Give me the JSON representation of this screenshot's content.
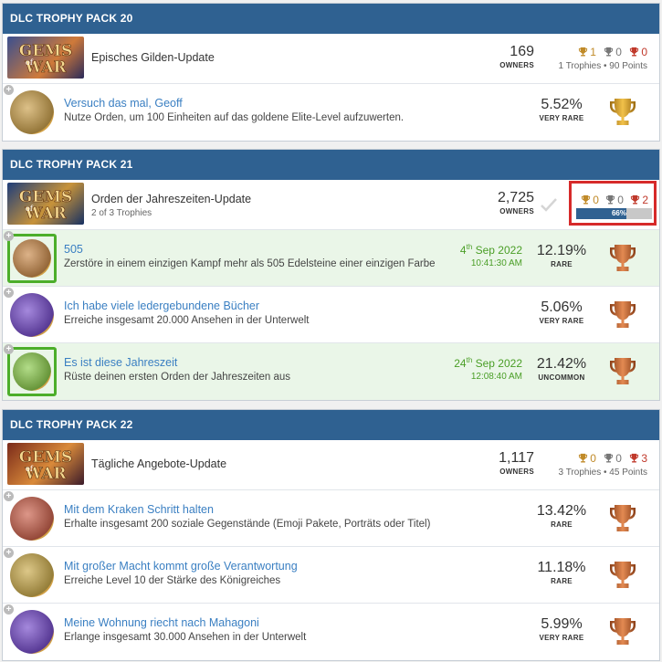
{
  "colors": {
    "header": "#2f6191",
    "earned_bg": "#eaf6e8",
    "earned_border": "#4cae2a",
    "link": "#3a7fc2",
    "date": "#4a9e26",
    "gold": "#c08a28",
    "bronze": "#c0392b",
    "highlight": "#d62a2a"
  },
  "packs": [
    {
      "header": "DLC TROPHY PACK 20",
      "pack": {
        "name": "Episches Gilden-Update",
        "subtitle": "",
        "owners": "169",
        "owners_label": "OWNERS",
        "gold": "1",
        "silver": "0",
        "bronze": "0",
        "meta": "1 Trophies • 90 Points",
        "icon": "gems-of-war-logo"
      },
      "trophies": [
        {
          "title": "Versuch das mal, Geoff",
          "desc": "Nutze Orden, um 100 Einheiten auf das goldene Elite-Level aufzuwerten.",
          "rarity": "5.52%",
          "rarity_label": "VERY RARE",
          "cup": "gold-trophy-icon",
          "earned": false,
          "date": "",
          "time": ""
        }
      ]
    },
    {
      "header": "DLC TROPHY PACK 21",
      "pack": {
        "name": "Orden der Jahreszeiten-Update",
        "subtitle": "2 of 3 Trophies",
        "owners": "2,725",
        "owners_label": "OWNERS",
        "gold": "0",
        "silver": "0",
        "bronze": "2",
        "progress": 66,
        "progress_label": "66%",
        "icon": "gems-of-war-logo"
      },
      "trophies": [
        {
          "title": "505",
          "desc": "Zerstöre in einem einzigen Kampf mehr als 505 Edelsteine einer einzigen Farbe",
          "rarity": "12.19%",
          "rarity_label": "RARE",
          "cup": "bronze-trophy-icon",
          "earned": true,
          "day": "4",
          "day_suffix": "th",
          "month_year": " Sep 2022",
          "time": "10:41:30 AM"
        },
        {
          "title": "Ich habe viele ledergebundene Bücher",
          "desc": "Erreiche insgesamt 20.000 Ansehen in der Unterwelt",
          "rarity": "5.06%",
          "rarity_label": "VERY RARE",
          "cup": "bronze-trophy-icon",
          "earned": false
        },
        {
          "title": "Es ist diese Jahreszeit",
          "desc": "Rüste deinen ersten Orden der Jahreszeiten aus",
          "rarity": "21.42%",
          "rarity_label": "UNCOMMON",
          "cup": "bronze-trophy-icon",
          "earned": true,
          "day": "24",
          "day_suffix": "th",
          "month_year": " Sep 2022",
          "time": "12:08:40 AM"
        }
      ]
    },
    {
      "header": "DLC TROPHY PACK 22",
      "pack": {
        "name": "Tägliche Angebote-Update",
        "subtitle": "",
        "owners": "1,117",
        "owners_label": "OWNERS",
        "gold": "0",
        "silver": "0",
        "bronze": "3",
        "meta": "3 Trophies • 45 Points",
        "icon": "gems-of-war-logo"
      },
      "trophies": [
        {
          "title": "Mit dem Kraken Schritt halten",
          "desc": "Erhalte insgesamt 200 soziale Gegenstände (Emoji Pakete, Porträts oder Titel)",
          "rarity": "13.42%",
          "rarity_label": "RARE",
          "cup": "bronze-trophy-icon",
          "earned": false
        },
        {
          "title": "Mit großer Macht kommt große Verantwortung",
          "desc": "Erreiche Level 10 der Stärke des Königreiches",
          "rarity": "11.18%",
          "rarity_label": "RARE",
          "cup": "bronze-trophy-icon",
          "earned": false
        },
        {
          "title": "Meine Wohnung riecht nach Mahagoni",
          "desc": "Erlange insgesamt 30.000 Ansehen in der Unterwelt",
          "rarity": "5.99%",
          "rarity_label": "VERY RARE",
          "cup": "bronze-trophy-icon",
          "earned": false
        }
      ]
    }
  ]
}
